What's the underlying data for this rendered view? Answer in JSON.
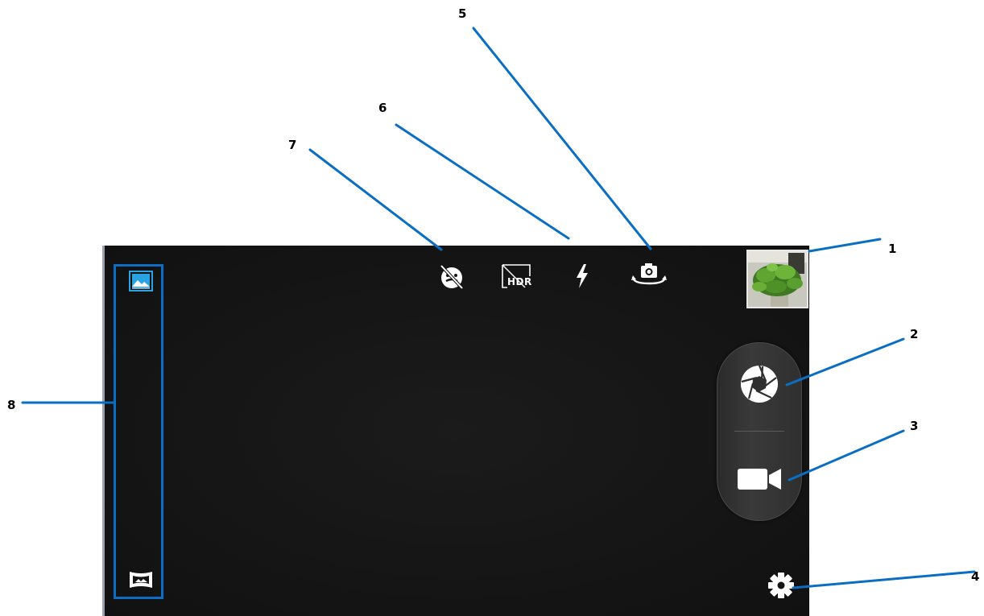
{
  "colors": {
    "screen_background": "#141414",
    "accent_blue": "#2aa3e3",
    "callout_line": "#0a6fc2",
    "icon_white": "#ffffff"
  },
  "top_controls": [
    {
      "name": "face-detection-off-icon",
      "label": "Face detection off"
    },
    {
      "name": "hdr-off-icon",
      "label": "HDR"
    },
    {
      "name": "flash-icon",
      "label": "Flash"
    },
    {
      "name": "switch-camera-icon",
      "label": "Switch camera"
    }
  ],
  "side_controls": {
    "thumbnail": "gallery-thumbnail",
    "shutter": "shutter-icon",
    "video": "video-camera-icon",
    "settings": "gear-icon"
  },
  "mode_bar": {
    "selected_mode": "photo-mode-icon",
    "other_mode": "panorama-mode-icon"
  },
  "hdr_text": "HDR",
  "callouts": [
    "1",
    "2",
    "3",
    "4",
    "5",
    "6",
    "7",
    "8"
  ]
}
